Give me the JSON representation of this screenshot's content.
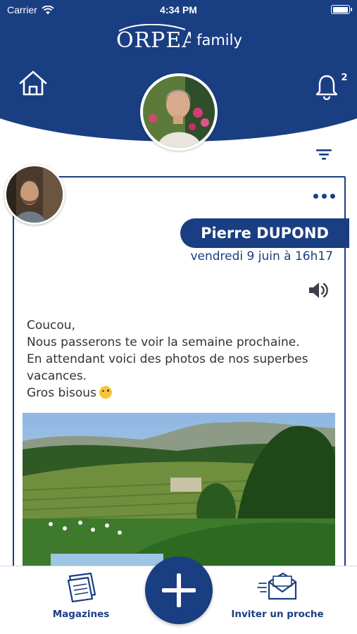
{
  "colors": {
    "primary": "#1a3e82",
    "background": "#ffffff"
  },
  "status_bar": {
    "carrier": "Carrier",
    "time": "4:34 PM",
    "battery_level": 1.0
  },
  "header": {
    "logo_text": "ORPEA",
    "family_text": "family",
    "home_icon": "home-icon",
    "notification_icon": "bell-icon",
    "notification_count": "2",
    "filter_icon": "filter-icon"
  },
  "post": {
    "author_name": "Pierre DUPOND",
    "date": "vendredi 9 juin à 16h17",
    "more_icon": "more-options-icon",
    "audio_icon": "speaker-icon",
    "message_lines": [
      "Coucou,",
      "Nous passerons te voir la semaine prochaine.",
      "En attendant voici des photos de nos superbes",
      "vacances.",
      "Gros bisous"
    ]
  },
  "bottom_nav": {
    "magazines_label": "Magazines",
    "add_icon": "plus-icon",
    "invite_label": "Inviter un proche"
  }
}
